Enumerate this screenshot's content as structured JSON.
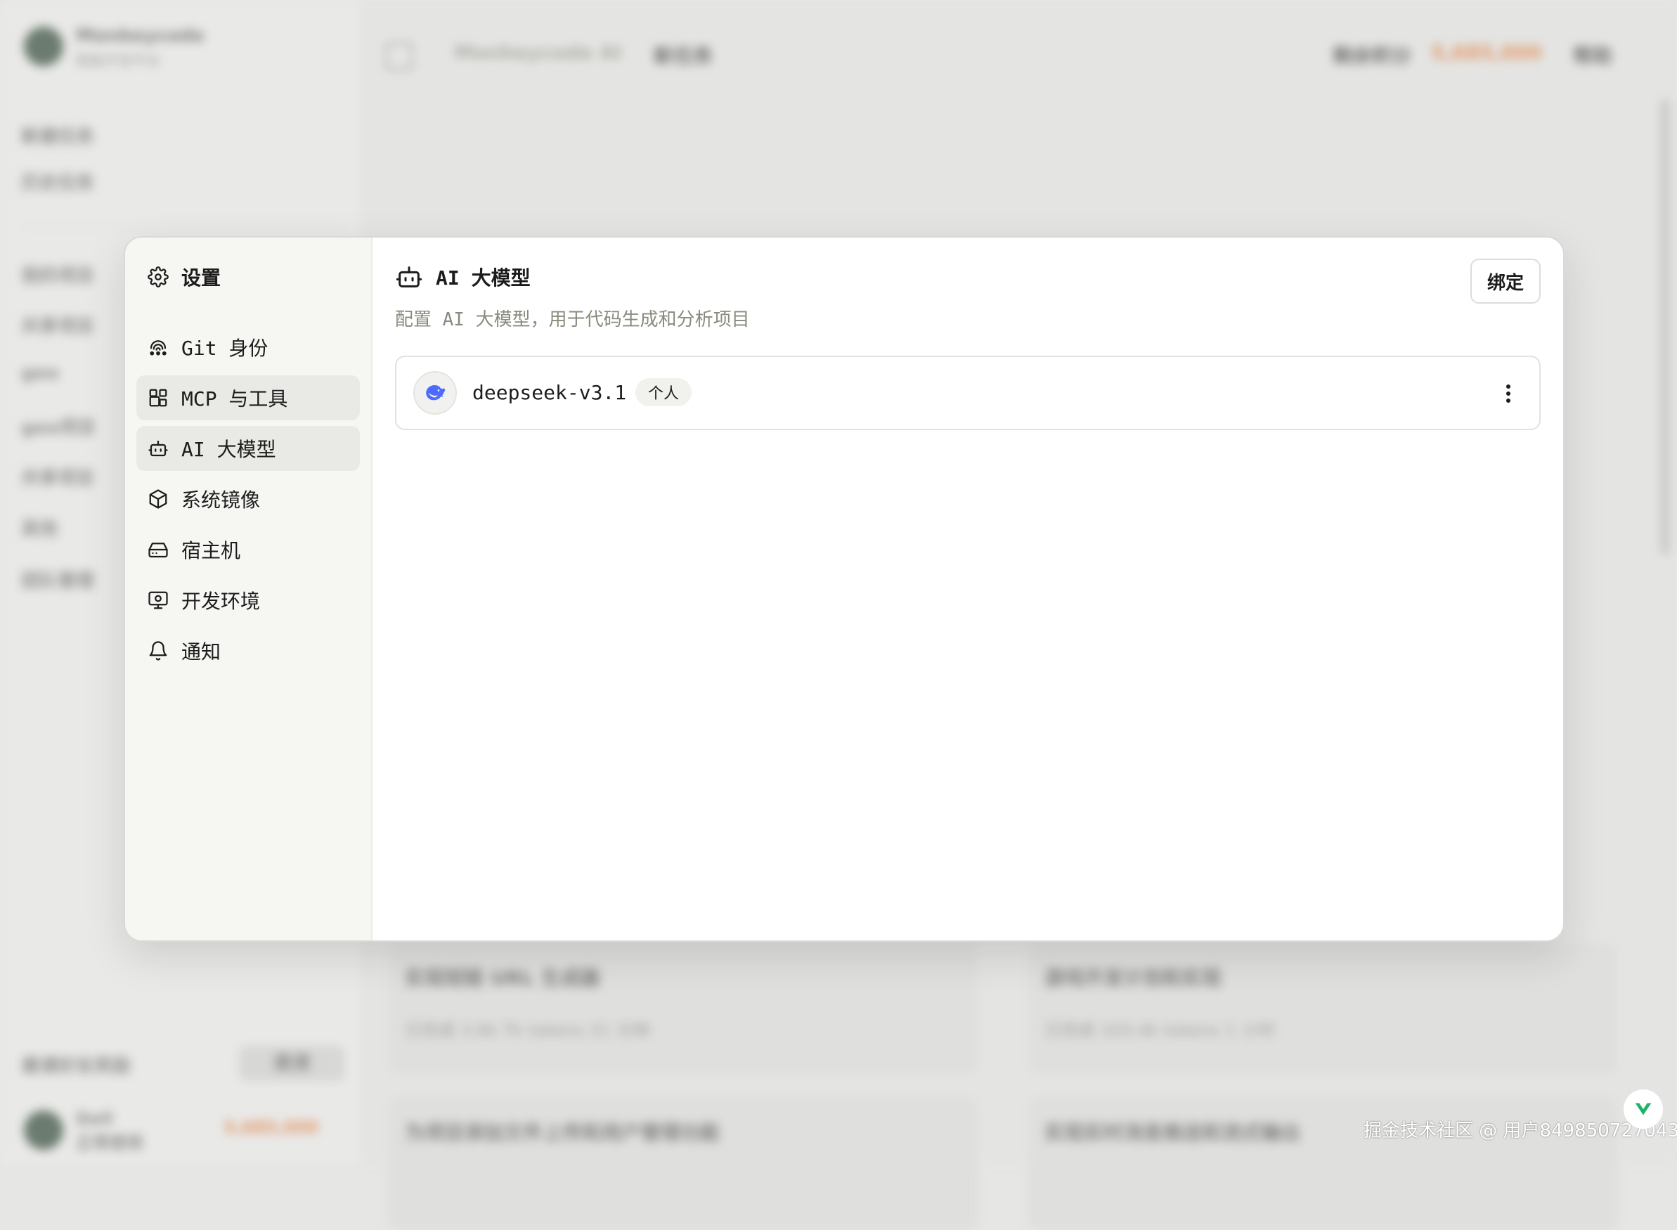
{
  "background": {
    "brand": "Monkeycode",
    "brand_sub": "智能开发平台",
    "sidebar_items": [
      "新建任务",
      "历史任务",
      "我的项目",
      "共享项目",
      "geo",
      "geo项目",
      "共享项目",
      "其他",
      "团队管理"
    ],
    "bottom_label": "邀请好友奖励",
    "bottom_btn": "邀请",
    "user_name": "Dell",
    "user_sub": "正常使用",
    "user_balance": "5,685,000",
    "crumb_root": "Monkeycode AI",
    "crumb_current": "新任务",
    "balance_label": "剩余积分",
    "balance_value": "5,685,000",
    "top_btn": "帮助",
    "cards": [
      {
        "title": "实现短链 URL 生成器",
        "meta": "已完成   3.6k Tk tokens   21 分钟"
      },
      {
        "title": "游戏开发计划和实现",
        "meta": "已完成   103.4k tokens   1 小时"
      },
      {
        "title": "为项目添加文件上传和用户管理功能",
        "meta": ""
      },
      {
        "title": "实现实时消息推送和流式输出",
        "meta": ""
      }
    ]
  },
  "settings": {
    "title": "设置",
    "nav": [
      {
        "label": "Git 身份",
        "icon": "git-identity-icon"
      },
      {
        "label": "MCP 与工具",
        "icon": "mcp-tools-icon"
      },
      {
        "label": "AI 大模型",
        "icon": "bot-icon"
      },
      {
        "label": "系统镜像",
        "icon": "box-icon"
      },
      {
        "label": "宿主机",
        "icon": "hard-drive-icon"
      },
      {
        "label": "开发环境",
        "icon": "monitor-icon"
      },
      {
        "label": "通知",
        "icon": "bell-icon"
      }
    ]
  },
  "panel": {
    "title": "AI 大模型",
    "description": "配置 AI 大模型，用于代码生成和分析项目",
    "bind_button": "绑定",
    "models": [
      {
        "name": "deepseek-v3.1",
        "tag": "个人",
        "icon": "deepseek-whale-icon"
      }
    ]
  },
  "watermark": "掘金技术社区 @ 用户849850727043",
  "colors": {
    "accent_muted": "#8b8a7c",
    "active_nav": "#e9e9e5",
    "deepseek_blue": "#4d6bfe"
  }
}
